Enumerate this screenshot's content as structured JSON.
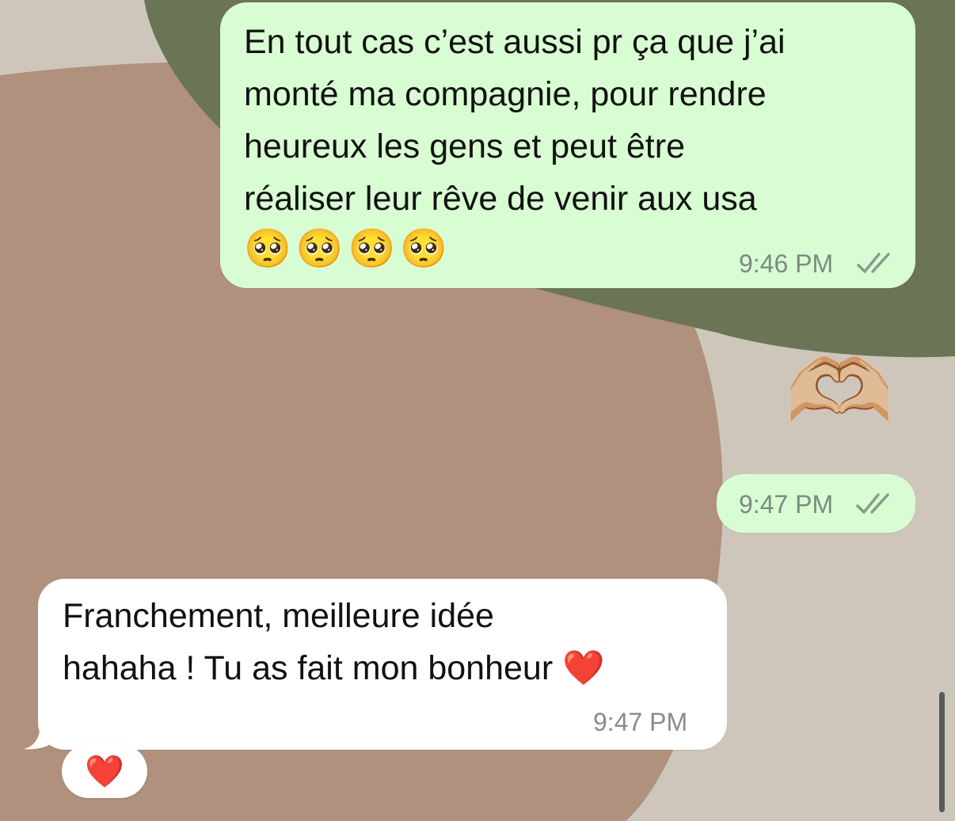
{
  "messages": {
    "outgoing_1": {
      "text": "En tout cas c’est aussi pr ça que j’ai\nmonté ma compagnie, pour rendre\nheureux les gens et peut être\nréaliser leur rêve de venir aux usa",
      "emojis": "🥺🥺🥺🥺",
      "time": "9:46 PM",
      "status": "read"
    },
    "outgoing_2": {
      "emoji": "🫶🏼",
      "time": "9:47 PM",
      "status": "read"
    },
    "incoming_1": {
      "text": "Franchement, meilleure idée\nhahaha ! Tu as fait mon bonheur ❤️",
      "time": "9:47 PM",
      "reaction": "❤️"
    }
  },
  "colors": {
    "outgoing_bubble": "#d9fdd3",
    "incoming_bubble": "#ffffff",
    "wallpaper_beige": "#cfc6bb",
    "wallpaper_tan": "#b0907c",
    "wallpaper_green": "#6a7455"
  },
  "icons": {
    "read_ticks": "double-check-icon"
  }
}
